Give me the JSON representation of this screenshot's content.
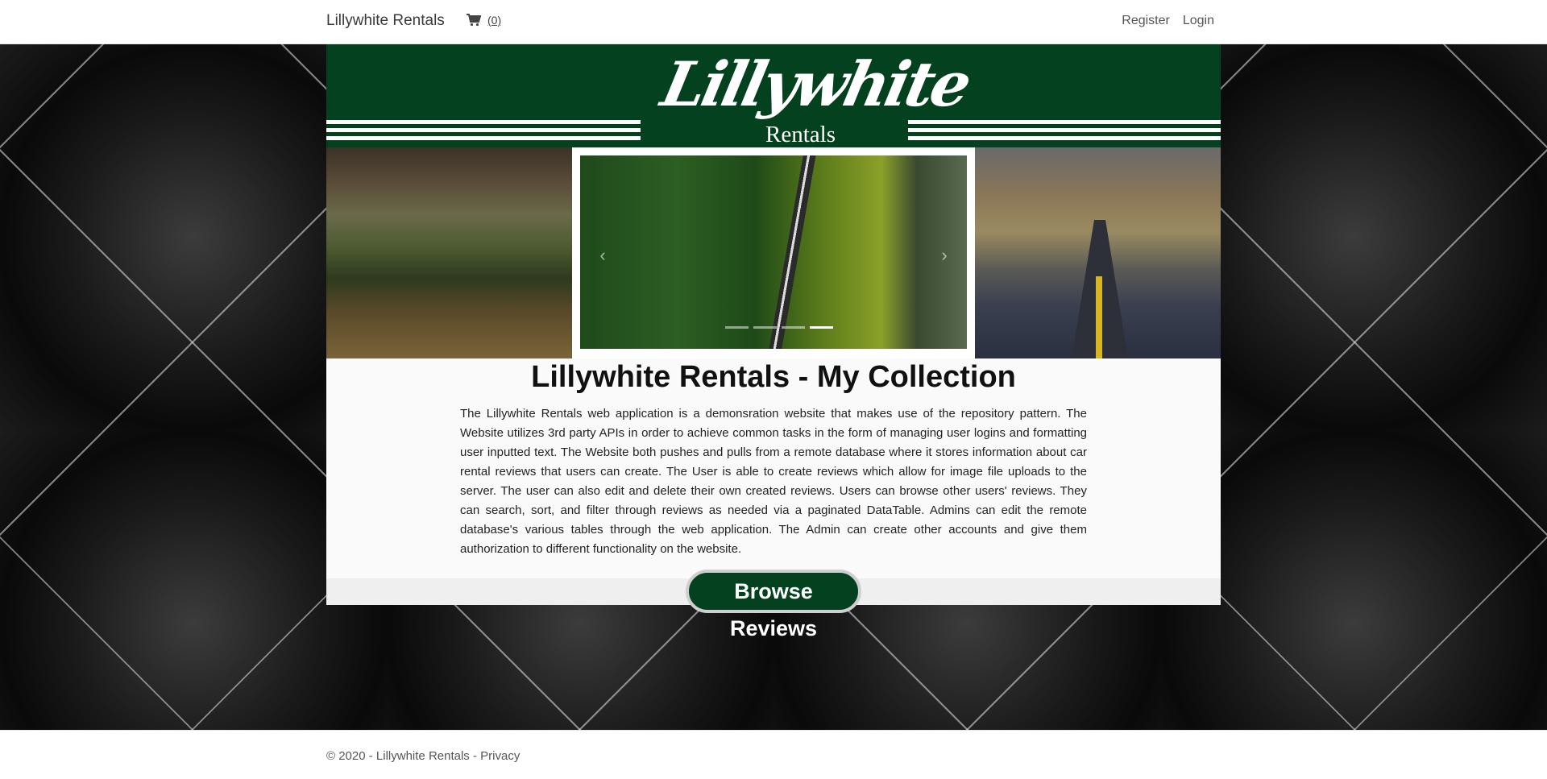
{
  "navbar": {
    "brand": "Lillywhite Rentals",
    "cart_icon": "shopping-cart-icon",
    "cart_count": "(0)",
    "register": "Register",
    "login": "Login"
  },
  "banner": {
    "logo_script": "Lillywhite",
    "logo_sub": "Rentals",
    "color": "#04421f"
  },
  "carousel": {
    "prev_icon": "chevron-left-icon",
    "next_icon": "chevron-right-icon",
    "slide_count": 4,
    "active_index": 3
  },
  "main": {
    "title": "Lillywhite Rentals - My Collection",
    "description": "The Lillywhite Rentals web application is a demonsration website that makes use of the repository pattern. The Website utilizes 3rd party APIs in order to achieve common tasks in the form of managing user logins and formatting user inputted text. The Website both pushes and pulls from a remote database where it stores information about car rental reviews that users can create. The User is able to create reviews which allow for image file uploads to the server. The user can also edit and delete their own created reviews. Users can browse other users' reviews. They can search, sort, and filter through reviews as needed via a paginated DataTable. Admins can edit the remote database's various tables through the web application. The Admin can create other accounts and give them authorization to different functionality on the website.",
    "browse_button": "Browse Reviews"
  },
  "footer": {
    "copyright": "© 2020 - Lillywhite Rentals - ",
    "privacy": "Privacy"
  }
}
